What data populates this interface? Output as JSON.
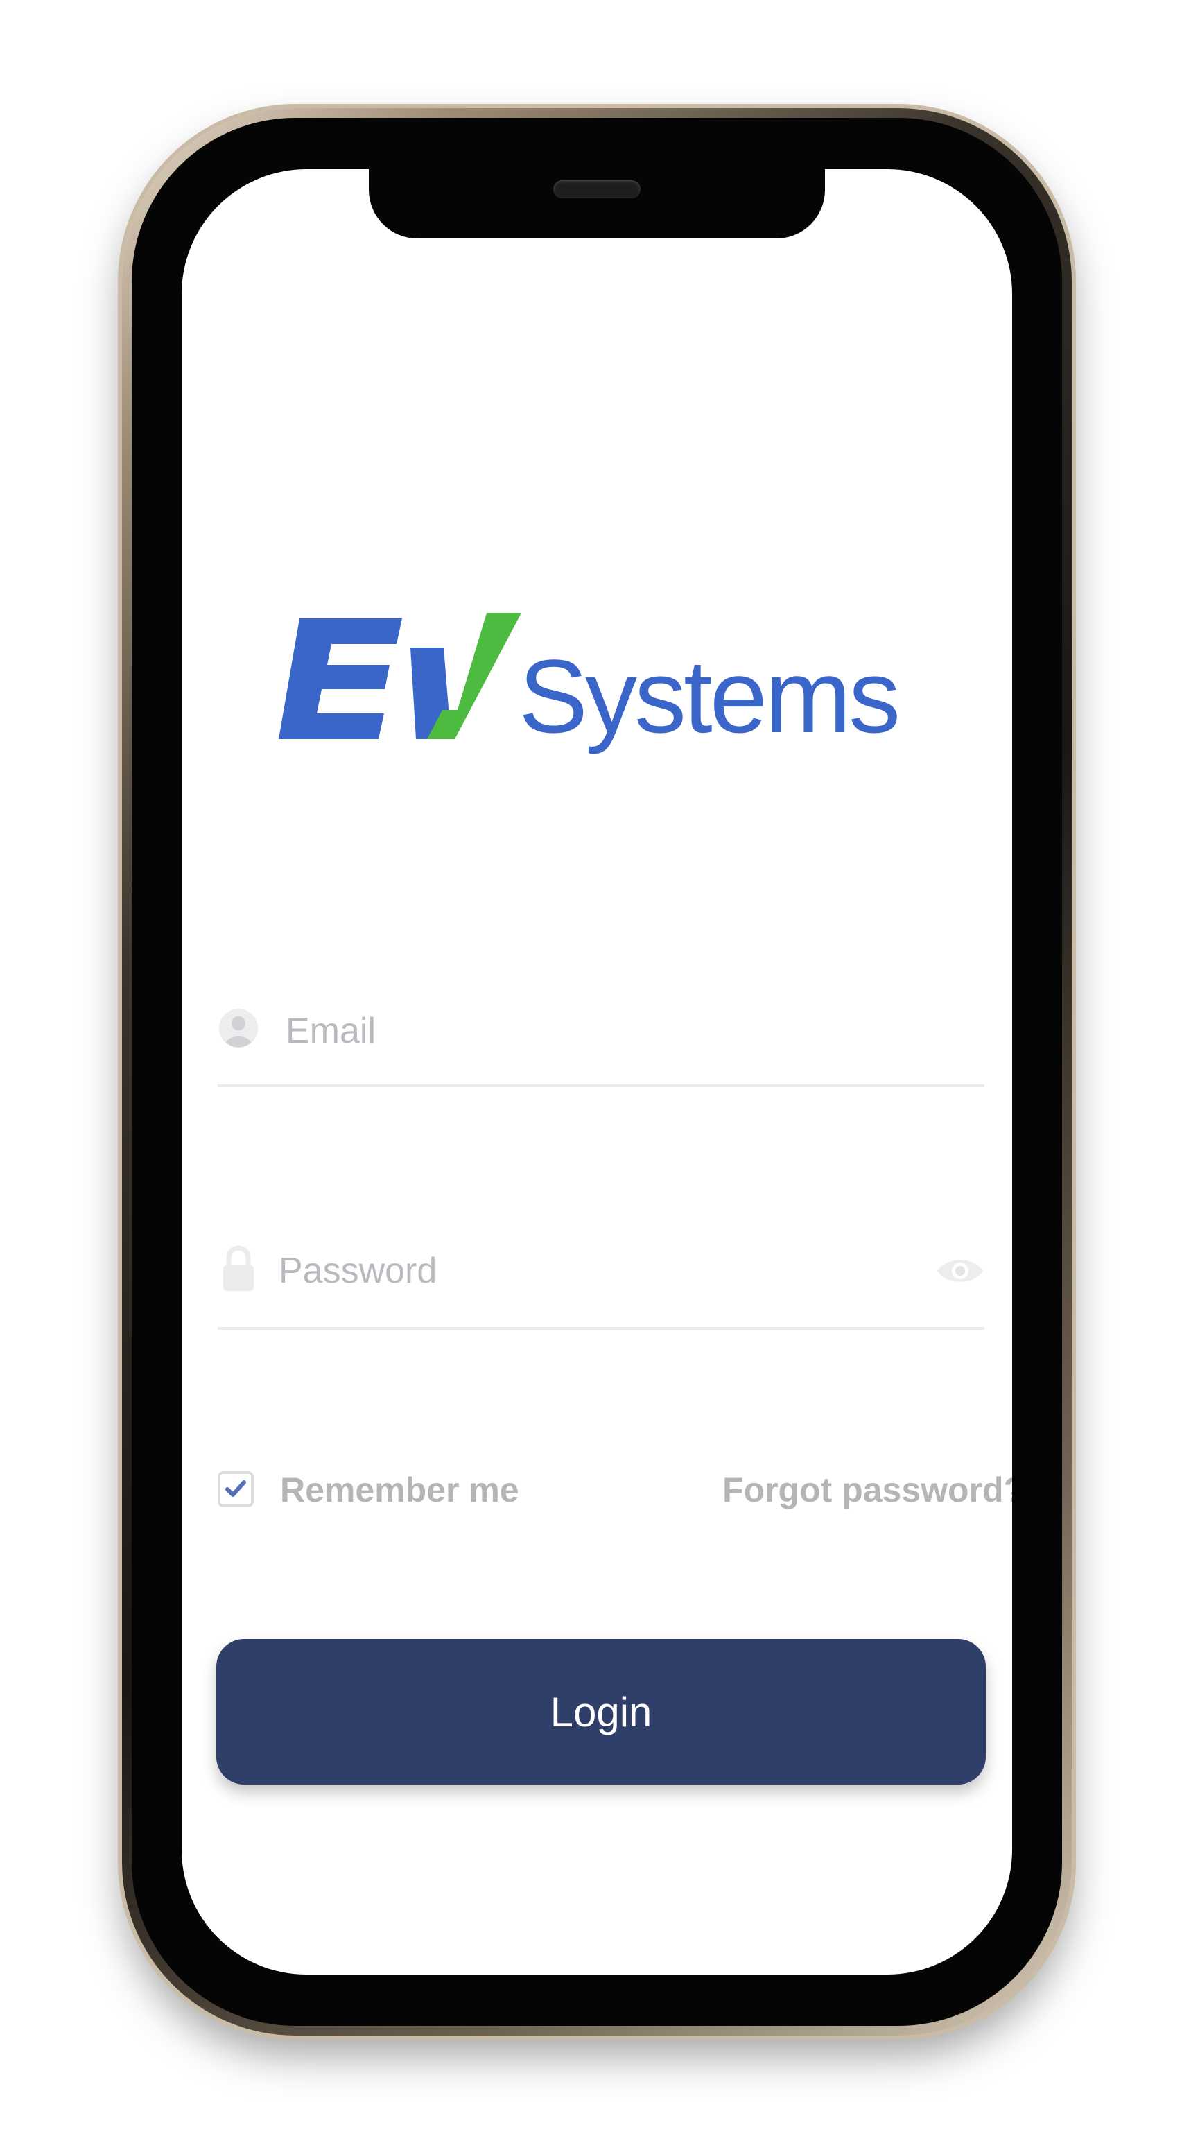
{
  "brand": {
    "logo_text_primary": "EV",
    "logo_text_secondary": "Systems",
    "colors": {
      "blue": "#3b66c9",
      "green": "#4cbb3f",
      "button": "#303f6a"
    }
  },
  "login_form": {
    "email": {
      "placeholder": "Email",
      "value": "",
      "icon": "user-icon"
    },
    "password": {
      "placeholder": "Password",
      "value": "",
      "icon": "lock-icon",
      "toggle_icon": "eye-icon"
    },
    "remember_me": {
      "label": "Remember me",
      "checked": true
    },
    "forgot_password_label": "Forgot password?",
    "login_button_label": "Login"
  }
}
